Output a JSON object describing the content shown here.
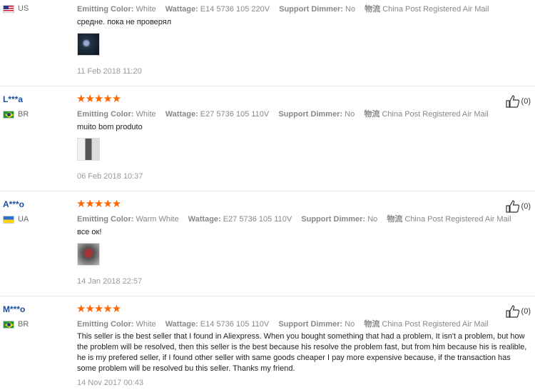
{
  "labels": {
    "emitting_color": "Emitting Color:",
    "wattage": "Wattage:",
    "support_dimmer": "Support Dimmer:",
    "shipping_prefix": "物流"
  },
  "reviews": [
    {
      "user": "",
      "country": "US",
      "stars": "★★★★★",
      "emitting_color": "White",
      "wattage": "E14 5736 105 220V",
      "dimmer": "No",
      "shipping": "China Post Registered Air Mail",
      "text": "средне. пока не проверял",
      "date": "11 Feb 2018 11:20",
      "helpful": ""
    },
    {
      "user": "L***a",
      "country": "BR",
      "stars": "★★★★★",
      "emitting_color": "White",
      "wattage": "E27 5736 105 110V",
      "dimmer": "No",
      "shipping": "China Post Registered Air Mail",
      "text": "muito bom produto",
      "date": "06 Feb 2018 10:37",
      "helpful": "(0)"
    },
    {
      "user": "A***o",
      "country": "UA",
      "stars": "★★★★★",
      "emitting_color": "Warm White",
      "wattage": "E27 5736 105 110V",
      "dimmer": "No",
      "shipping": "China Post Registered Air Mail",
      "text": "все ок!",
      "date": "14 Jan 2018 22:57",
      "helpful": "(0)"
    },
    {
      "user": "M***o",
      "country": "BR",
      "stars": "★★★★★",
      "emitting_color": "White",
      "wattage": "E14 5736 105 110V",
      "dimmer": "No",
      "shipping": "China Post Registered Air Mail",
      "text": "This seller is the best seller that I found in Aliexpress. When you bought something that had a problem, It isn't a problem, but how the problem will be resolved, then this seller is the best because his resolve the problem fast, but from him because his is realible, he is my prefered seller, if I found other seller with same goods cheaper I pay more expensive because, if the transaction has some problem will be resolved bu this seller. Thanks my friend.",
      "date": "14 Nov 2017 00:43",
      "helpful": "(0)"
    }
  ],
  "colors": {
    "star": "#ff6600",
    "username": "#1a4fa0"
  }
}
